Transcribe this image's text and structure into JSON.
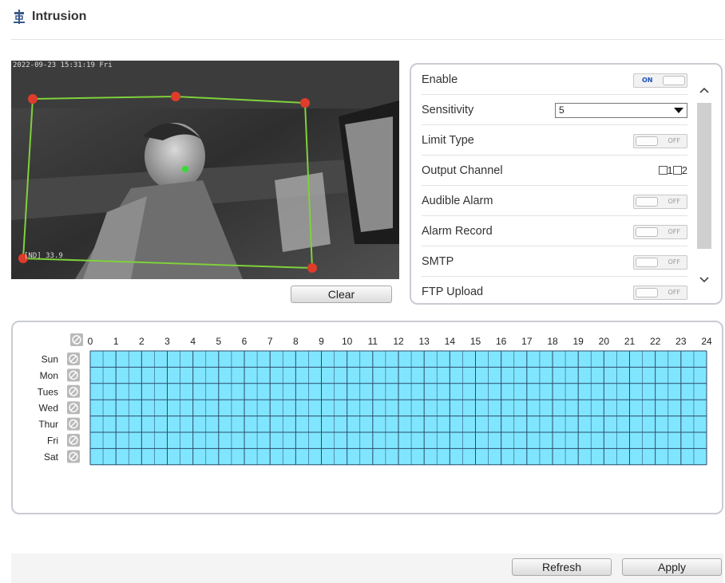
{
  "header": {
    "title": "Intrusion",
    "icon": "intrusion-icon"
  },
  "video": {
    "timestamp": "2022-09-23 15:31:19 Fri",
    "temperature": "[ND] 33.9"
  },
  "clear_label": "Clear",
  "settings": {
    "enable": {
      "label": "Enable",
      "state": "ON"
    },
    "sensitivity": {
      "label": "Sensitivity",
      "value": "5"
    },
    "limit_type": {
      "label": "Limit Type",
      "state": "OFF"
    },
    "output_channel": {
      "label": "Output Channel",
      "channels": [
        "1",
        "2"
      ]
    },
    "audible_alarm": {
      "label": "Audible Alarm",
      "state": "OFF"
    },
    "alarm_record": {
      "label": "Alarm Record",
      "state": "OFF"
    },
    "smtp": {
      "label": "SMTP",
      "state": "OFF"
    },
    "ftp_upload": {
      "label": "FTP Upload",
      "state": "OFF"
    }
  },
  "schedule": {
    "hours": [
      "0",
      "1",
      "2",
      "3",
      "4",
      "5",
      "6",
      "7",
      "8",
      "9",
      "10",
      "11",
      "12",
      "13",
      "14",
      "15",
      "16",
      "17",
      "18",
      "19",
      "20",
      "21",
      "22",
      "23",
      "24"
    ],
    "days": [
      "Sun",
      "Mon",
      "Tues",
      "Wed",
      "Thur",
      "Fri",
      "Sat"
    ],
    "fill_color": "#80e6ff",
    "all_selected": true
  },
  "buttons": {
    "refresh": "Refresh",
    "apply": "Apply"
  }
}
